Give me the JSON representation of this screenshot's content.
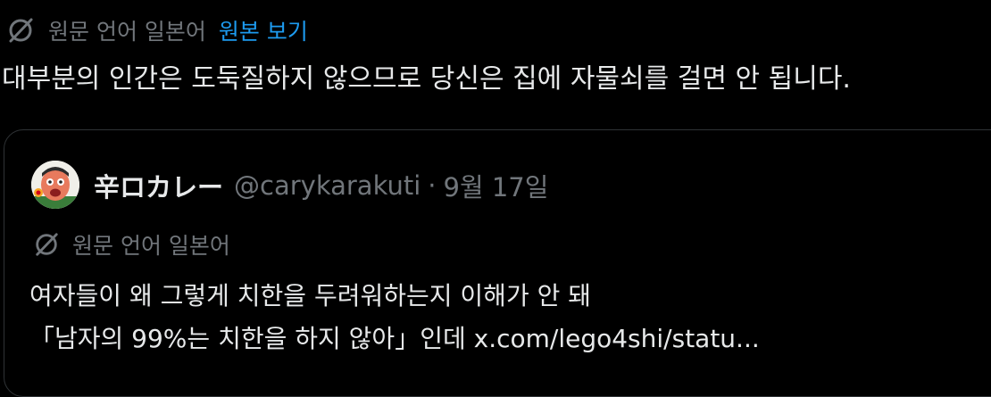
{
  "translation": {
    "label": "원문 언어 일본어",
    "show_original": "원본 보기"
  },
  "post": {
    "text": "대부분의 인간은 도둑질하지 않으므로 당신은 집에 자물쇠를 걸면 안 됩니다."
  },
  "quote": {
    "author_name": "辛ロカレー",
    "handle": "@carykarakuti",
    "separator": "·",
    "date": "9월 17일",
    "translation_label": "원문 언어 일본어",
    "line1": "여자들이 왜 그렇게 치한을 두려워하는지 이해가 안 돼",
    "line2_text": "「남자의 99%는 치한을 하지 않아」인데 ",
    "line2_link": "x.com/lego4shi/statu..."
  },
  "colors": {
    "background": "#000000",
    "text": "#e7e9ea",
    "muted": "#71767b",
    "link": "#1d9bf0",
    "border": "#2f3336"
  },
  "icons": {
    "translate": "translate-slash-icon",
    "avatar": "cartoon-face-avatar"
  }
}
